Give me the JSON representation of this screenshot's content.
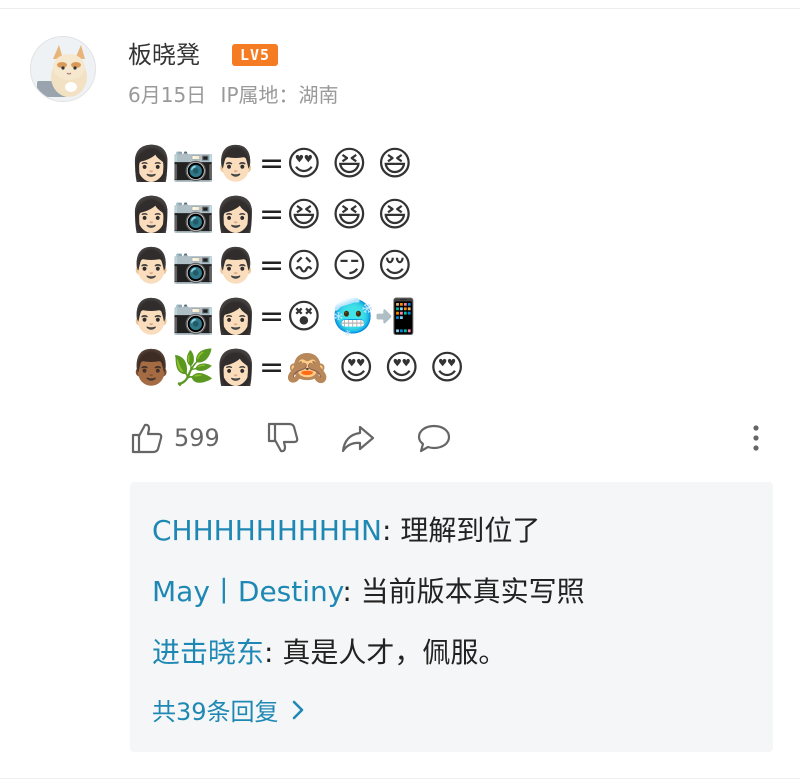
{
  "post": {
    "username": "板晓凳",
    "level": "LV5",
    "date": "6月15日",
    "ip_location": "IP属地：湖南",
    "emoji_rows": [
      {
        "left": "👩🏻📷👨🏻",
        "eq": "=",
        "right": [
          "😍",
          "😆",
          "😆"
        ]
      },
      {
        "left": "👩🏻📷👩🏻",
        "eq": "=",
        "right": [
          "😆",
          "😆",
          "😆"
        ]
      },
      {
        "left": "👨🏻📷👨🏻",
        "eq": "=",
        "right": [
          "😖",
          "😏",
          "😌"
        ]
      },
      {
        "left": "👨🏻📷👩🏻",
        "eq": "=",
        "right": [
          "😵",
          "🥶",
          "📲"
        ]
      },
      {
        "left": "👨🏾🌿👩🏻",
        "eq": "=",
        "right": [
          "🙈",
          "😍",
          "😍",
          "😍"
        ]
      }
    ]
  },
  "actions": {
    "like_count": "599",
    "icons": [
      "thumb-up-icon",
      "thumb-down-icon",
      "share-icon",
      "comment-icon",
      "more-vertical-icon"
    ]
  },
  "replies": {
    "items": [
      {
        "user": "CHHHHHHHHHN",
        "sep": ": ",
        "text": "理解到位了"
      },
      {
        "user": "May丨Destiny",
        "sep": ": ",
        "text": "当前版本真实写照"
      },
      {
        "user": "进击晓东",
        "sep": ": ",
        "text": "真是人才，佩服。"
      }
    ],
    "more_label": "共39条回复"
  },
  "colors": {
    "accent_link": "#1e88b4",
    "level_badge": "#f57c22",
    "reply_bg": "#f5f6f7"
  }
}
